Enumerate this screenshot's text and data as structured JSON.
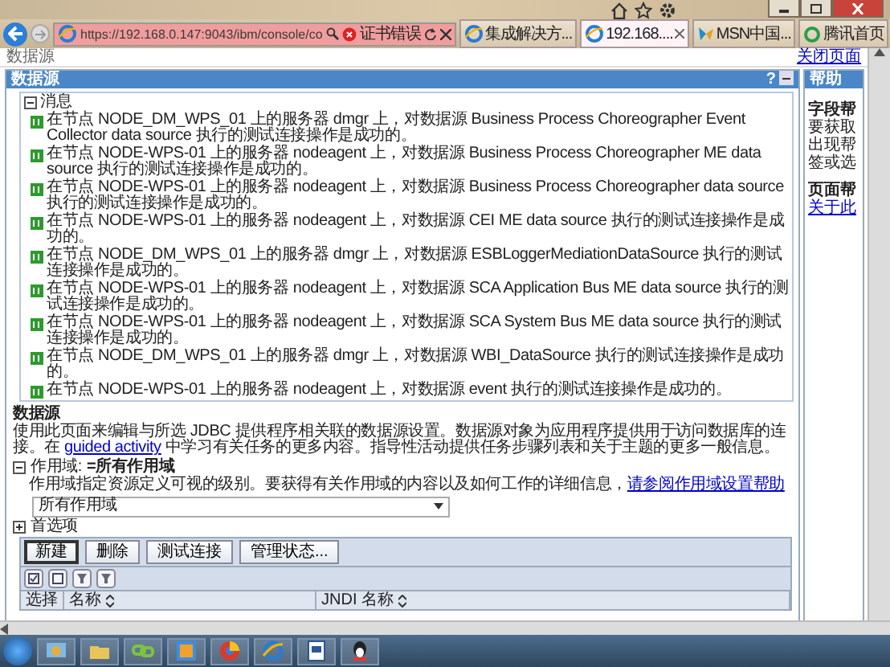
{
  "browser": {
    "address": "https://192.168.0.147:9043/ibm/console/co",
    "cert_error": "证书错误",
    "tabs": [
      {
        "label": "集成解决方...",
        "selected": false
      },
      {
        "label": "192.168....",
        "selected": true
      },
      {
        "label": "MSN中国...",
        "selected": false
      },
      {
        "label": "腾讯首页",
        "selected": false
      }
    ]
  },
  "page": {
    "breadcrumb": "数据源",
    "close_link": "关闭页面"
  },
  "panel": {
    "title": "数据源",
    "help_mark": "?",
    "messages": {
      "title": "消息",
      "expanded": true,
      "items": [
        "在节点 NODE_DM_WPS_01 上的服务器 dmgr 上，对数据源 Business Process Choreographer Event Collector data source 执行的测试连接操作是成功的。",
        "在节点 NODE-WPS-01 上的服务器 nodeagent 上，对数据源 Business Process Choreographer ME data source 执行的测试连接操作是成功的。",
        "在节点 NODE-WPS-01 上的服务器 nodeagent 上，对数据源 Business Process Choreographer data source 执行的测试连接操作是成功的。",
        "在节点 NODE-WPS-01 上的服务器 nodeagent 上，对数据源 CEI ME data source 执行的测试连接操作是成功的。",
        "在节点 NODE_DM_WPS_01 上的服务器 dmgr 上，对数据源 ESBLoggerMediationDataSource 执行的测试连接操作是成功的。",
        "在节点 NODE-WPS-01 上的服务器 nodeagent 上，对数据源 SCA Application Bus ME data source 执行的测试连接操作是成功的。",
        "在节点 NODE-WPS-01 上的服务器 nodeagent 上，对数据源 SCA System Bus ME data source 执行的测试连接操作是成功的。",
        "在节点 NODE_DM_WPS_01 上的服务器 dmgr 上，对数据源 WBI_DataSource 执行的测试连接操作是成功的。",
        "在节点 NODE-WPS-01 上的服务器 nodeagent 上，对数据源 event 执行的测试连接操作是成功的。"
      ]
    },
    "section_title": "数据源",
    "description_before": "使用此页面来编辑与所选 JDBC 提供程序相关联的数据源设置。数据源对象为应用程序提供用于访问数据库的连接。在 ",
    "description_link": "guided activity",
    "description_after": " 中学习有关任务的更多内容。指导性活动提供任务步骤列表和关于主题的更多一般信息。",
    "scope": {
      "expanded": true,
      "label": "作用域:",
      "value": "=所有作用域",
      "help_text": "作用域指定资源定义可视的级别。要获得有关作用域的内容以及如何工作的详细信息，",
      "help_link": "请参阅作用域设置帮助",
      "selected_scope": "所有作用域"
    },
    "preferences": {
      "expanded": false,
      "label": "首选项"
    },
    "buttons": [
      "新建",
      "删除",
      "测试连接",
      "管理状态..."
    ],
    "columns": [
      "选择",
      "名称",
      "JNDI 名称"
    ]
  },
  "help": {
    "title": "帮助",
    "field_help_title": "字段帮",
    "field_help_lines": [
      "要获取",
      "出现帮",
      "签或选"
    ],
    "page_help_title": "页面帮",
    "page_help_link": "关于此"
  }
}
